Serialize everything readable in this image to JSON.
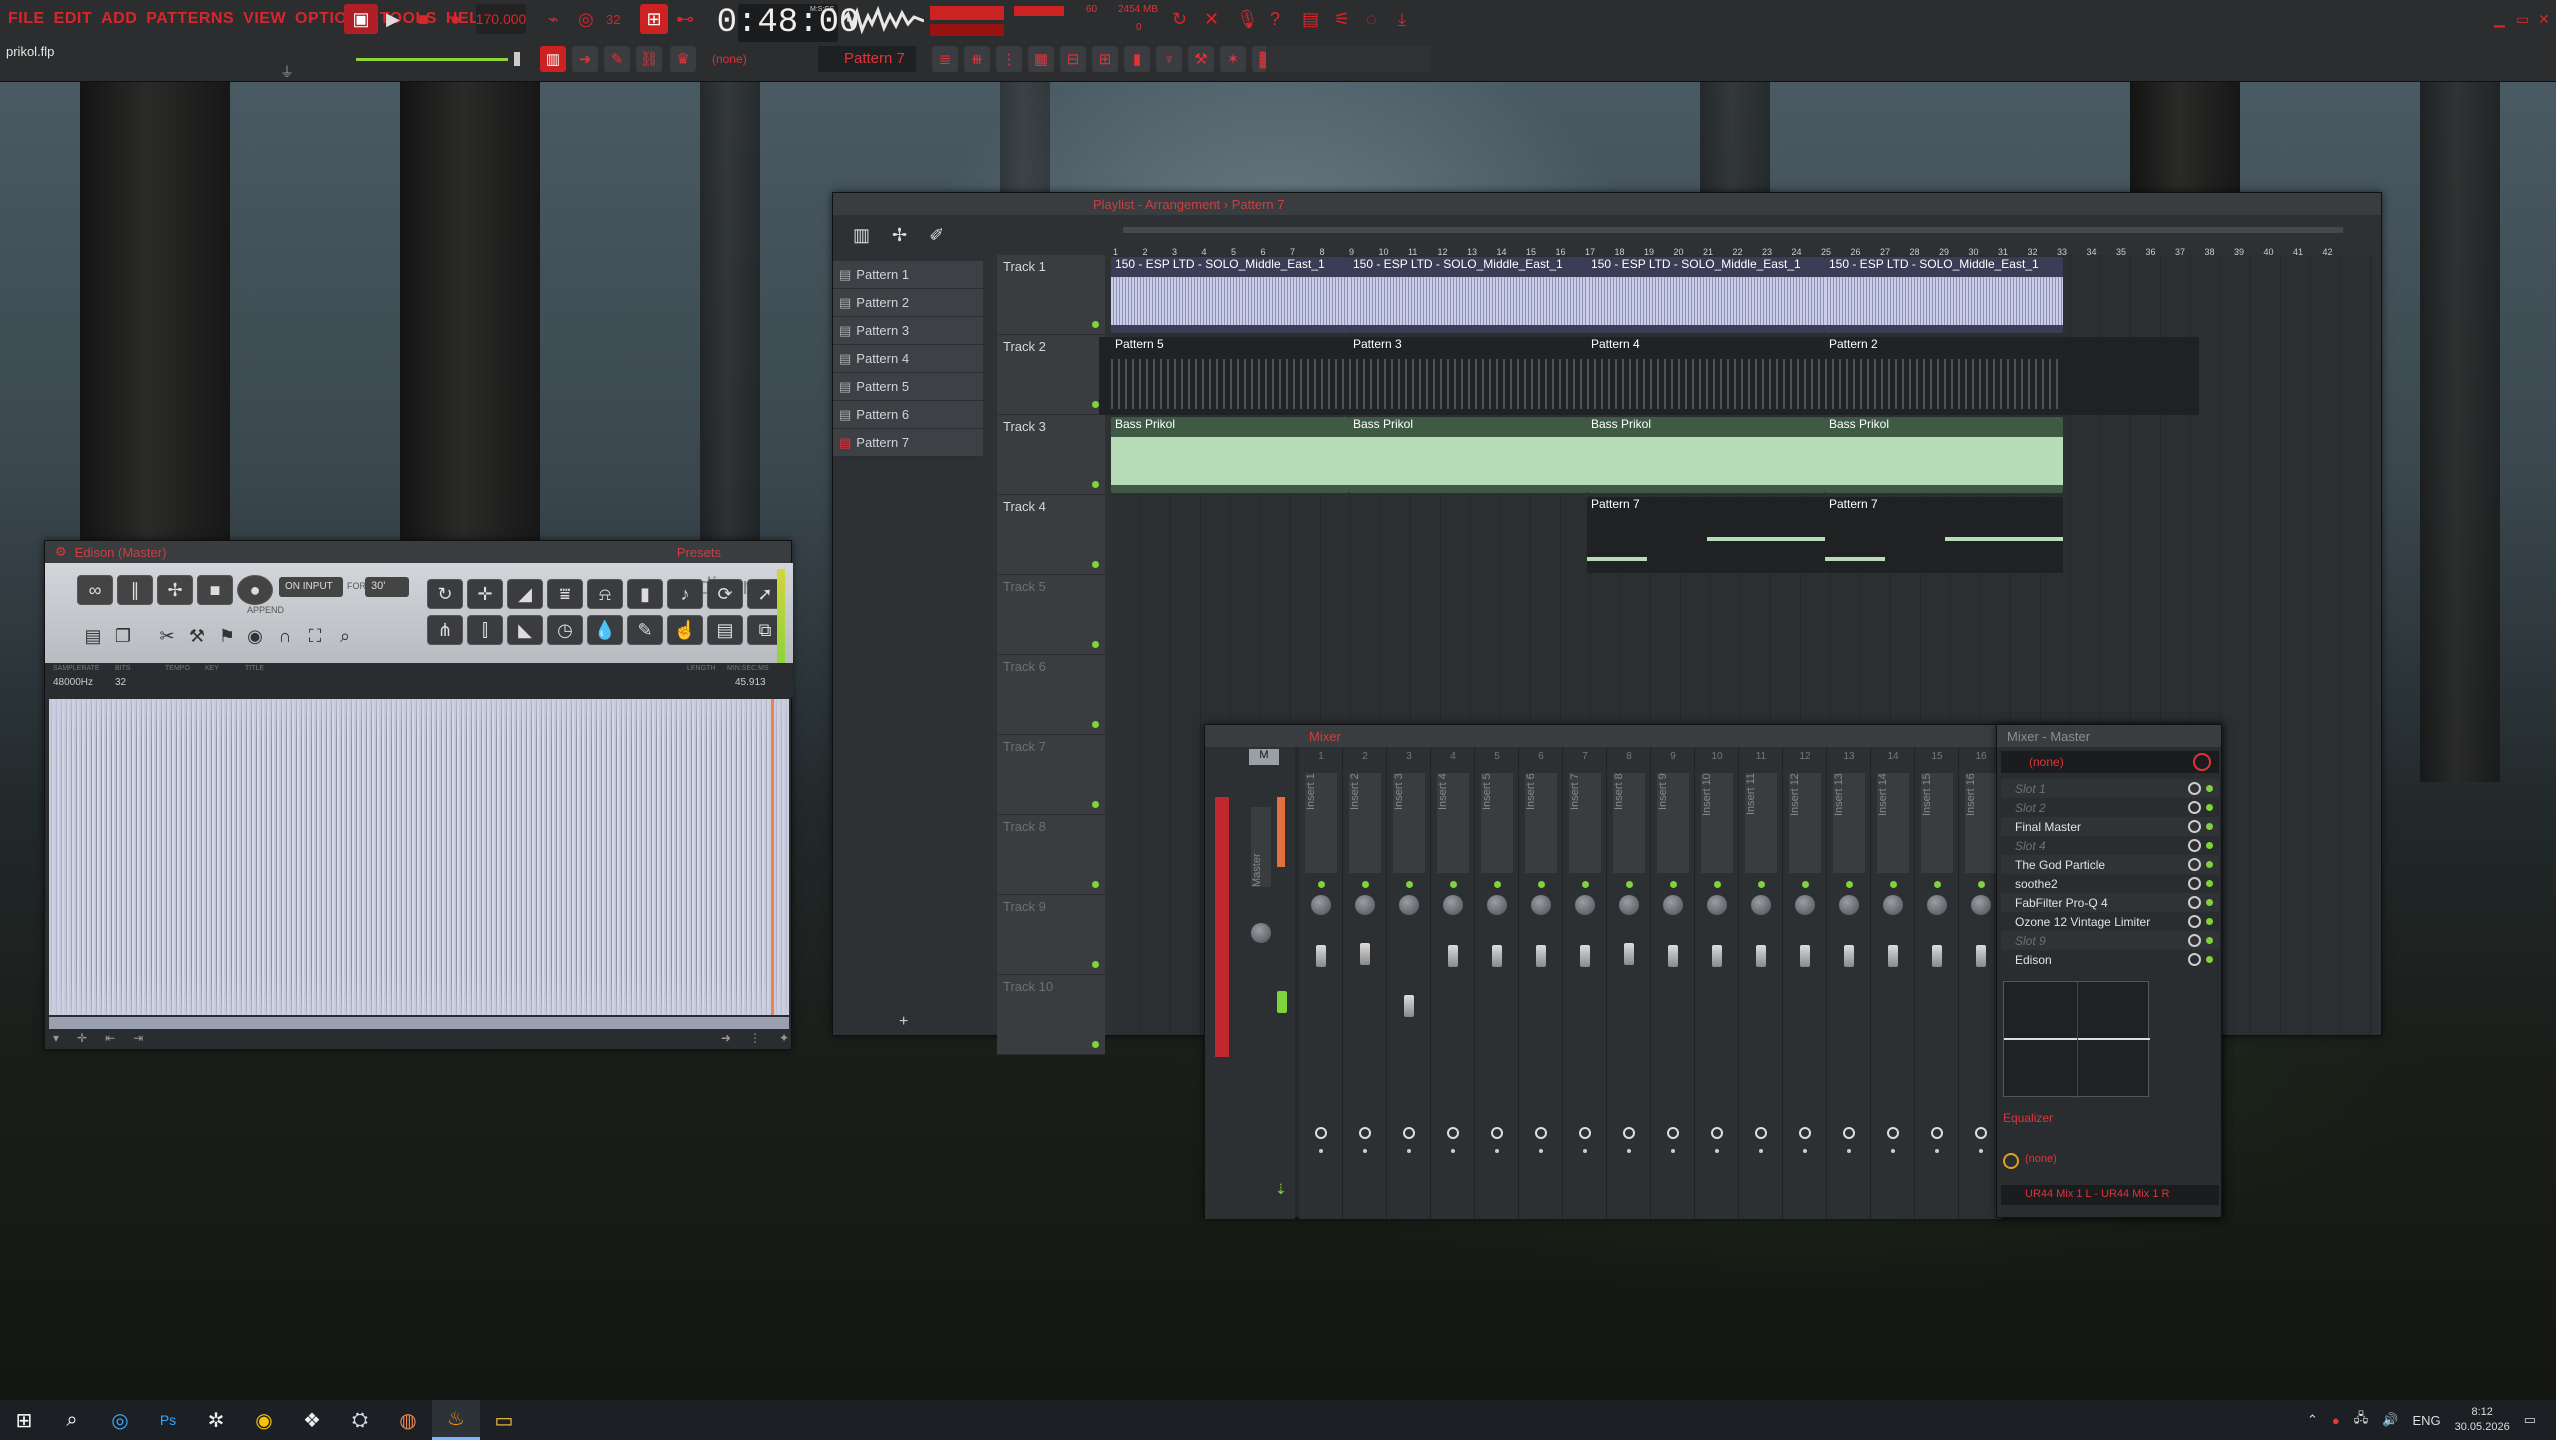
{
  "topbar": {
    "menu": [
      "FILE",
      "EDIT",
      "ADD",
      "PATTERNS",
      "VIEW",
      "OPTIONS",
      "TOOLS",
      "HELP"
    ],
    "tempo": "170.000",
    "time": "0:48:00",
    "time_unit": "M:S:CS",
    "cpu": "60",
    "mem": "2454 MB",
    "mem_zero": "0",
    "project": "prikol.flp",
    "channel_none": "(none)",
    "pattern": "Pattern 7"
  },
  "playlist": {
    "title": "Playlist - Arrangement › Pattern 7",
    "patterns": [
      "Pattern 1",
      "Pattern 2",
      "Pattern 3",
      "Pattern 4",
      "Pattern 5",
      "Pattern 6",
      "Pattern 7"
    ],
    "tracks": [
      "Track 1",
      "Track 2",
      "Track 3",
      "Track 4",
      "Track 5",
      "Track 6",
      "Track 7",
      "Track 8",
      "Track 9",
      "Track 10"
    ],
    "ruler": [
      "1",
      "2",
      "3",
      "4",
      "5",
      "6",
      "7",
      "8",
      "9",
      "10",
      "11",
      "12",
      "13",
      "14",
      "15",
      "16",
      "17",
      "18",
      "19",
      "20",
      "21",
      "22",
      "23",
      "24",
      "25",
      "26",
      "27",
      "28",
      "29",
      "30",
      "31",
      "32",
      "33",
      "34",
      "35",
      "36",
      "37",
      "38",
      "39",
      "40",
      "41",
      "42"
    ],
    "audio_clip": "150 - ESP LTD - SOLO_Middle_East_1",
    "track2_clips": [
      "Pattern 5",
      "Pattern 3",
      "Pattern 4",
      "Pattern 2"
    ],
    "bass_clip": "Bass Prikol",
    "p7_clip": "Pattern 7"
  },
  "edison": {
    "title": "Edison (Master)",
    "presets": "Presets",
    "on_input": "ON INPUT",
    "for": "FOR",
    "secs": "30'",
    "append": "APPEND",
    "brand": "edison",
    "sample_rate": "48000Hz",
    "bits": "32",
    "len": "45.913",
    "h_sr": "SAMPLERATE",
    "h_bits": "BITS",
    "h_tempo": "TEMPO",
    "h_key": "KEY",
    "h_title": "TITLE",
    "h_len": "LENGTH",
    "h_ms": "MIN:SEC:MS"
  },
  "mixer": {
    "title": "Mixer",
    "master": "Master",
    "m_label": "M",
    "inserts": [
      "Insert 1",
      "Insert 2",
      "Insert 3",
      "Insert 4",
      "Insert 5",
      "Insert 6",
      "Insert 7",
      "Insert 8",
      "Insert 9",
      "Insert 10",
      "Insert 11",
      "Insert 12",
      "Insert 13",
      "Insert 14",
      "Insert 15",
      "Insert 16"
    ],
    "nums": [
      "1",
      "2",
      "3",
      "4",
      "5",
      "6",
      "7",
      "8",
      "9",
      "10",
      "11",
      "12",
      "13",
      "14",
      "15",
      "16"
    ]
  },
  "fx": {
    "title": "Mixer - Master",
    "none": "(none)",
    "slots": [
      {
        "label": "Slot 1",
        "dim": true
      },
      {
        "label": "Slot 2",
        "dim": true
      },
      {
        "label": "Final Master",
        "dim": false
      },
      {
        "label": "Slot 4",
        "dim": true
      },
      {
        "label": "The God Particle",
        "dim": false
      },
      {
        "label": "soothe2",
        "dim": false
      },
      {
        "label": "FabFilter Pro-Q 4",
        "dim": false
      },
      {
        "label": "Ozone 12 Vintage Limiter",
        "dim": false
      },
      {
        "label": "Slot 9",
        "dim": true
      },
      {
        "label": "Edison",
        "dim": false
      }
    ],
    "eq": "Equalizer",
    "out_none": "(none)",
    "output": "UR44 Mix 1 L - UR44 Mix 1 R"
  },
  "taskbar": {
    "lang": "ENG",
    "time": "8:12",
    "date": "30.05.2026"
  },
  "colors": {
    "accent": "#e0333a",
    "green": "#7fd43b",
    "audio": "#c9cde8",
    "bass": "#b9dcb8"
  }
}
